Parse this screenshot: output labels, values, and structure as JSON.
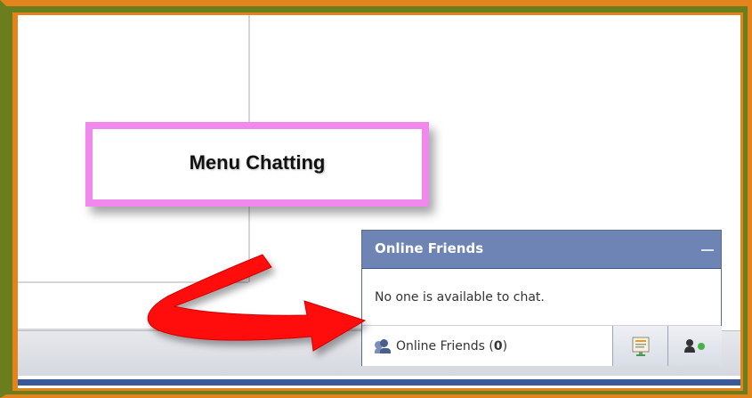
{
  "annotation": {
    "callout_label": "Menu Chatting",
    "border_color": "#f188ee",
    "arrow_color": "#ff0000"
  },
  "chat": {
    "header_title": "Online Friends",
    "empty_message": "No one is available to chat.",
    "footer_label": "Online Friends",
    "online_count": "0",
    "header_color": "#6d84b4",
    "status_color": "#44b244"
  },
  "icons": {
    "minimize": "minimize-icon",
    "friends": "friends-icon",
    "chat_window": "chat-window-icon",
    "status": "user-status-icon"
  }
}
